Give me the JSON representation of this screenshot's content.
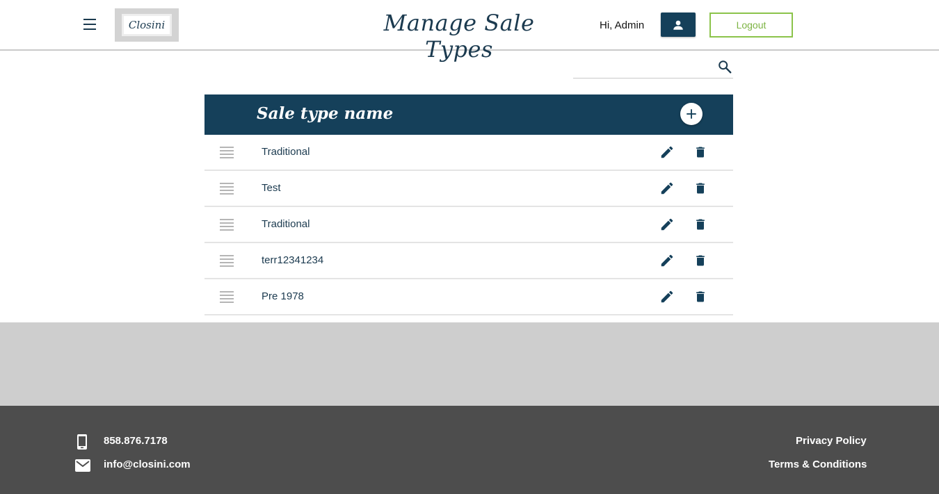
{
  "header": {
    "logo_text": "Closini",
    "title": "Manage Sale Types",
    "greeting": "Hi, Admin",
    "logout_label": "Logout"
  },
  "search": {
    "value": "",
    "placeholder": ""
  },
  "table": {
    "column_title": "Sale type name",
    "rows": [
      {
        "label": "Traditional"
      },
      {
        "label": "Test"
      },
      {
        "label": "Traditional"
      },
      {
        "label": "terr12341234"
      },
      {
        "label": "Pre 1978"
      }
    ]
  },
  "footer": {
    "phone": "858.876.7178",
    "email": "info@closini.com",
    "privacy": "Privacy Policy",
    "terms": "Terms & Conditions"
  },
  "icons": {
    "menu": "hamburger-menu-icon",
    "profile": "person-icon",
    "search": "search-icon",
    "add": "plus-icon",
    "drag": "drag-handle-icon",
    "edit": "pencil-icon",
    "delete": "trash-icon",
    "phone": "phone-icon",
    "email": "mail-icon"
  },
  "colors": {
    "primary": "#15405a",
    "logout_green": "#8bc34a",
    "footer_bg": "#4d4d4d",
    "band_bg": "#cecece"
  }
}
